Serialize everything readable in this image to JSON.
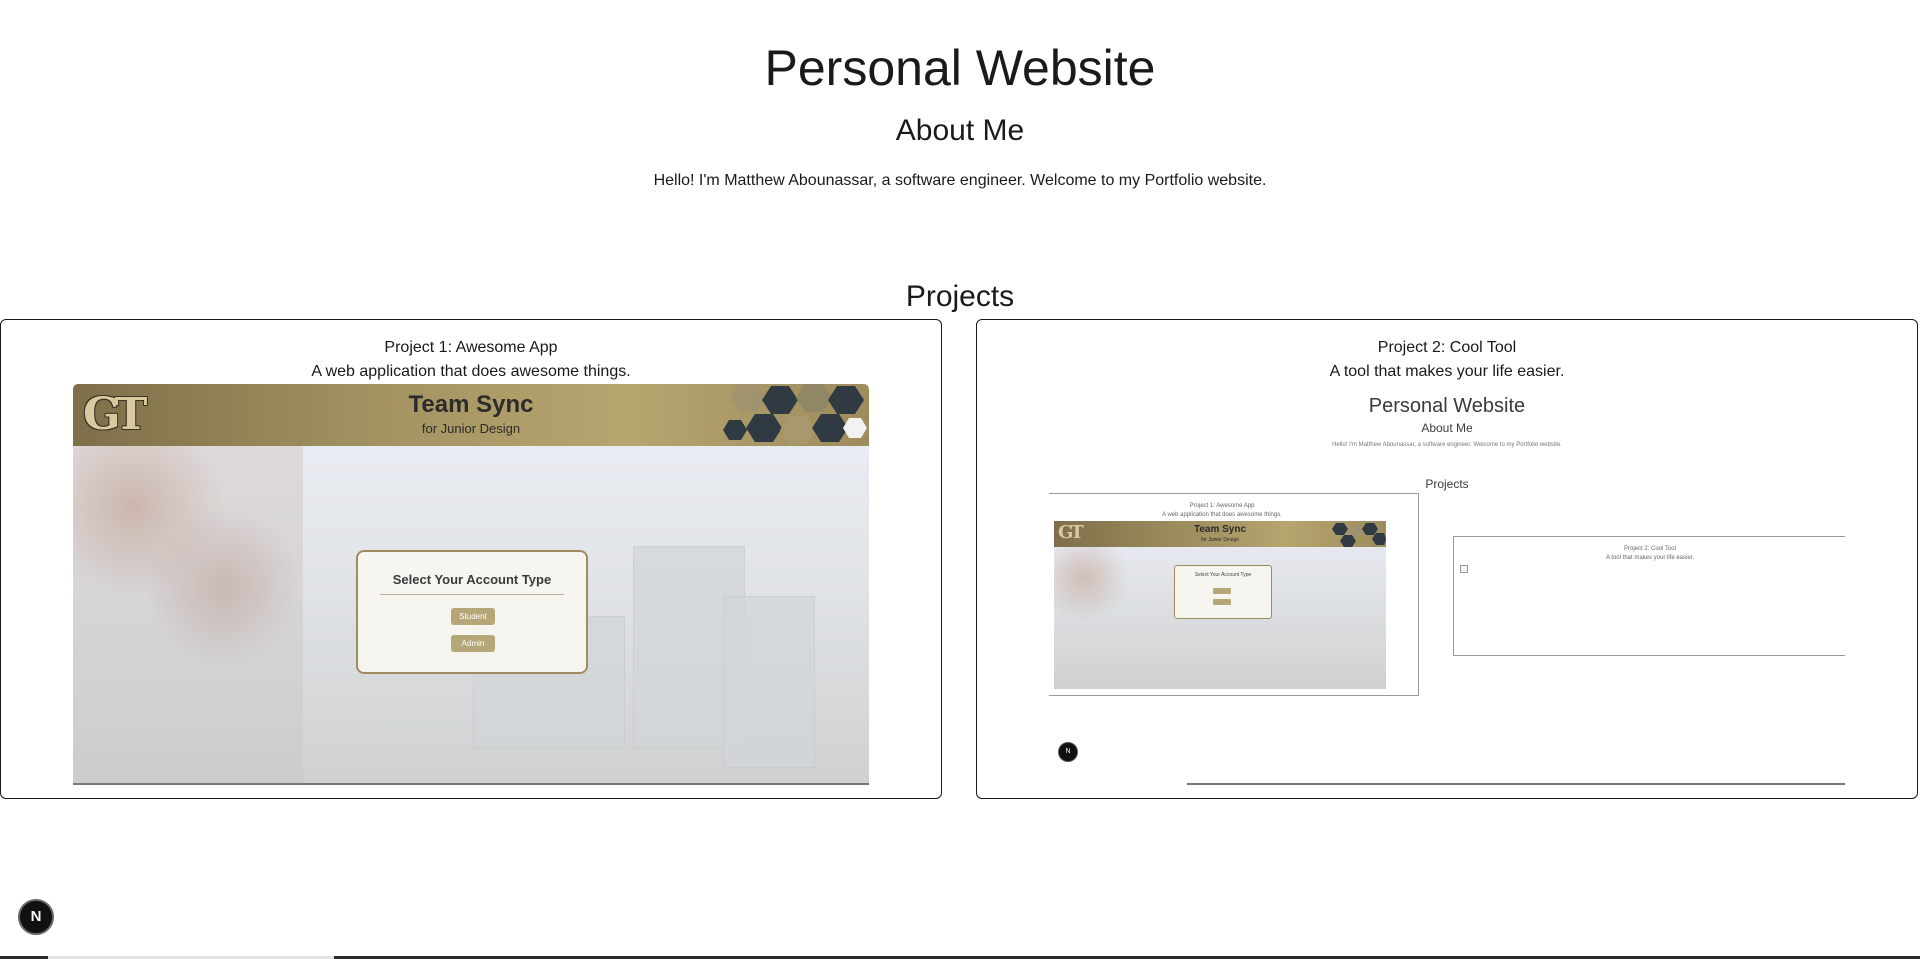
{
  "header": {
    "title": "Personal Website",
    "about_heading": "About Me",
    "about_text": "Hello! I'm Matthew Abounassar, a software engineer. Welcome to my Portfolio website."
  },
  "projects": {
    "heading": "Projects",
    "items": [
      {
        "title": "Project 1: Awesome App",
        "description": "A web application that does awesome things.",
        "preview": {
          "logo": "GT",
          "title": "Team Sync",
          "subtitle": "for Junior Design",
          "dialog_title": "Select Your Account Type",
          "buttons": [
            "Student",
            "Admin"
          ],
          "accent": "#b6a778"
        }
      },
      {
        "title": "Project 2: Cool Tool",
        "description": "A tool that makes your life easier.",
        "preview": {
          "site_title": "Personal Website",
          "about_heading": "About Me",
          "about_text": "Hello! I'm Matthew Abounassar, a software engineer. Welcome to my Portfolio website.",
          "projects_heading": "Projects",
          "card_1_title": "Project 1: Awesome App",
          "card_1_desc": "A web application that does awesome things.",
          "card_2_title": "Project 2: Cool Tool",
          "card_2_desc": "A tool that makes your life easier.",
          "mini_logo": "GT",
          "mini_title": "Team Sync",
          "mini_subtitle": "for Junior Design",
          "mini_dialog_title": "Select Your Account Type",
          "badge": "N"
        }
      }
    ]
  },
  "dev_badge": {
    "label": "N",
    "icon": "nextjs-icon"
  }
}
